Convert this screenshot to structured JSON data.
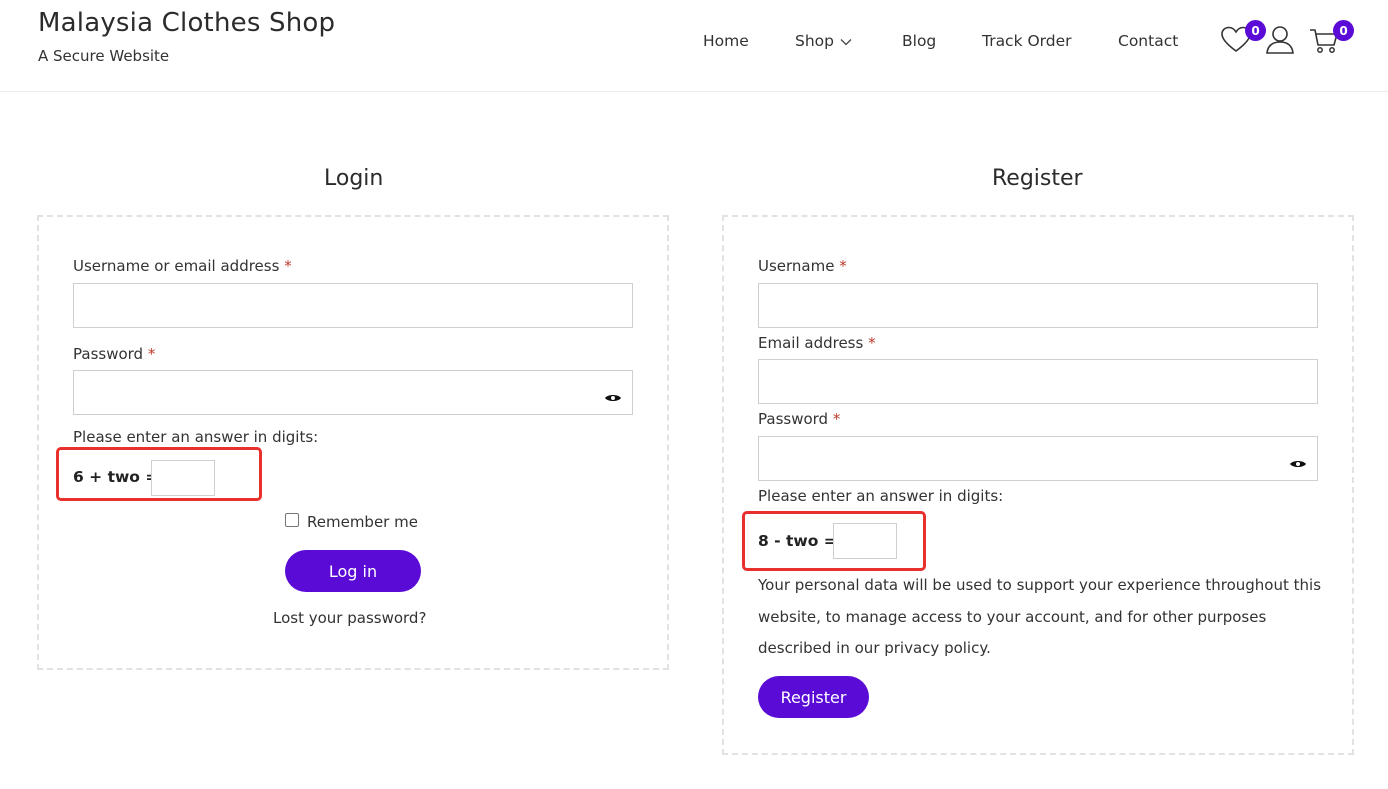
{
  "site": {
    "title": "Malaysia Clothes Shop",
    "tagline": "A Secure Website"
  },
  "nav": {
    "items": [
      "Home",
      "Shop",
      "Blog",
      "Track Order",
      "Contact"
    ]
  },
  "header_icons": {
    "wishlist": {
      "icon": "heart-icon",
      "count": "0"
    },
    "account": {
      "icon": "user-icon"
    },
    "cart": {
      "icon": "cart-icon",
      "count": "0"
    }
  },
  "login": {
    "title": "Login",
    "username_label": "Username or email address",
    "password_label": "Password",
    "required_mark": "*",
    "captcha_prompt": "Please enter an answer in digits:",
    "captcha_equation": "6 + two =",
    "remember_label": "Remember me",
    "submit_label": "Log in",
    "lost_password": "Lost your password?"
  },
  "register": {
    "title": "Register",
    "username_label": "Username",
    "email_label": "Email address",
    "password_label": "Password",
    "required_mark": "*",
    "captcha_prompt": "Please enter an answer in digits:",
    "captcha_equation": "8 - two =",
    "privacy_text": "Your personal data will be used to support your experience throughout this website, to manage access to your account, and for other purposes described in our privacy policy.",
    "submit_label": "Register"
  },
  "colors": {
    "accent": "#5b0bd6",
    "required": "#c0392b",
    "highlight": "#e8302c"
  }
}
